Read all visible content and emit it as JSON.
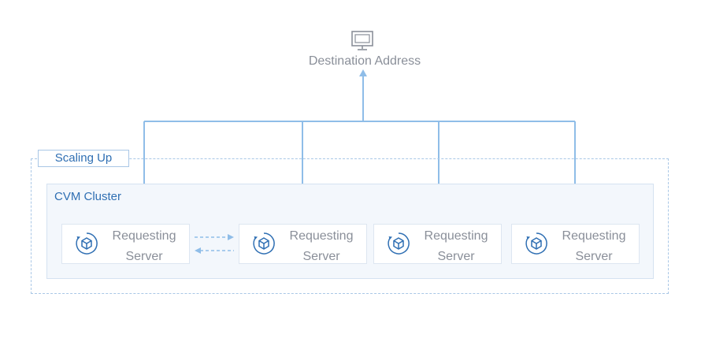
{
  "destination": {
    "label": "Destination Address",
    "icon": "monitor-icon"
  },
  "scaling": {
    "label": "Scaling Up"
  },
  "cluster": {
    "label": "CVM Cluster",
    "servers": [
      {
        "line1": "Requesting",
        "line2": "Server",
        "icon": "cvm-server-icon"
      },
      {
        "line1": "Requesting",
        "line2": "Server",
        "icon": "cvm-server-icon"
      },
      {
        "line1": "Requesting",
        "line2": "Server",
        "icon": "cvm-server-icon"
      },
      {
        "line1": "Requesting",
        "line2": "Server",
        "icon": "cvm-server-icon"
      }
    ]
  },
  "colors": {
    "connector": "#8fbde8",
    "accent_text": "#2f6fb3",
    "muted_text": "#8a8f99",
    "dashed_border": "#a9c7e6",
    "cluster_fill": "#f3f7fc"
  }
}
